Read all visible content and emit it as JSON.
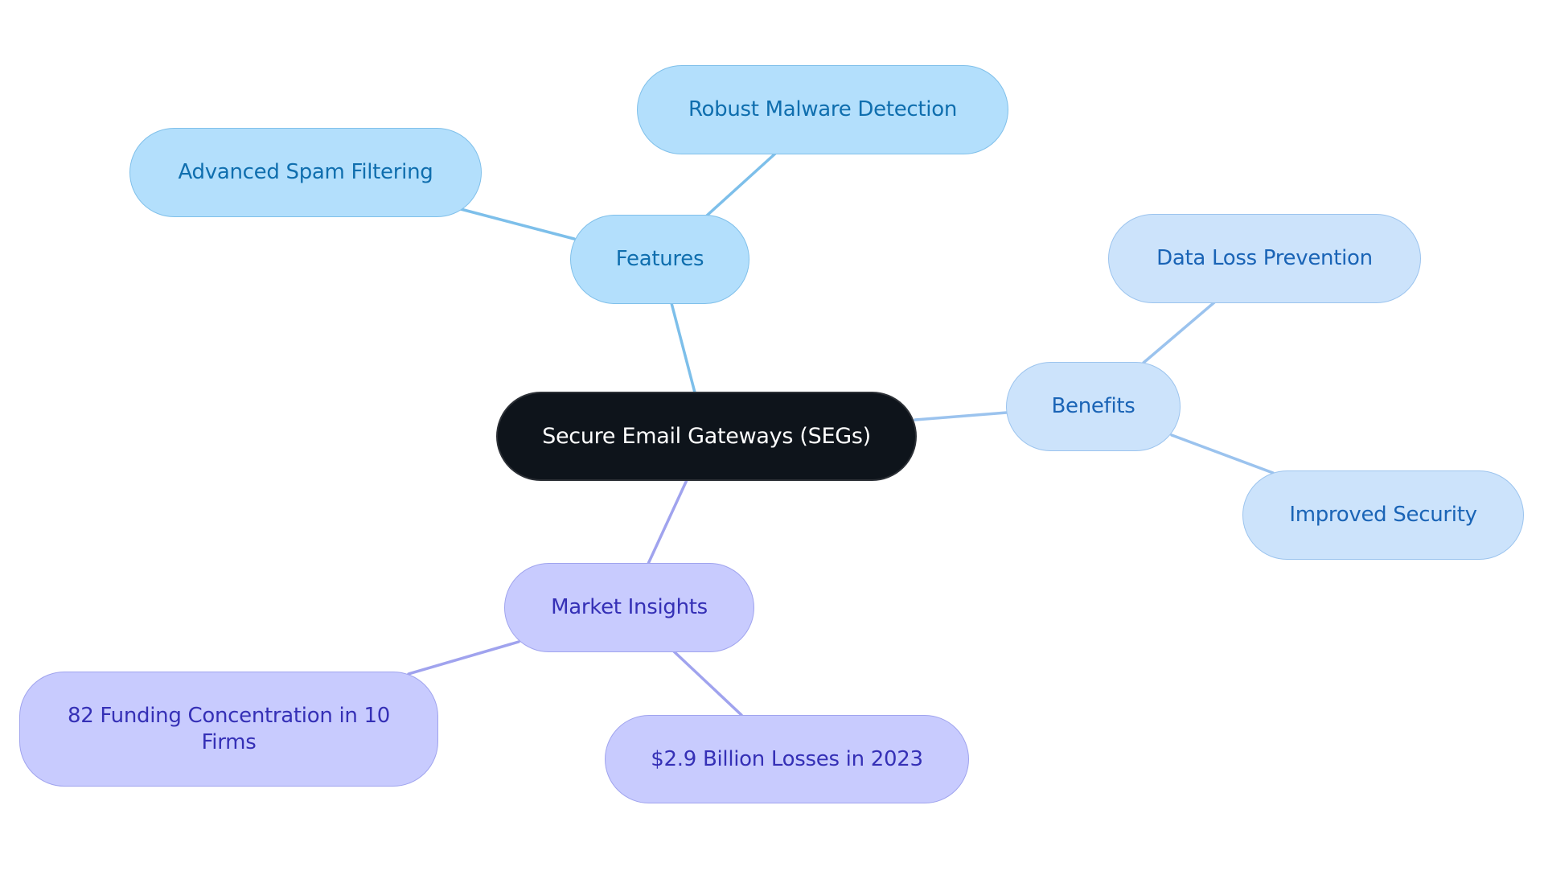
{
  "diagram": {
    "type": "mindmap",
    "root": {
      "label": "Secure Email Gateways (SEGs)",
      "colors": {
        "fill": "#0e141b",
        "border": "#2c3036",
        "text": "#ffffff"
      }
    },
    "branches": [
      {
        "id": "features",
        "label": "Features",
        "colors": {
          "fill": "#b3dffc",
          "border": "#80c0ea",
          "text": "#0f6eae",
          "edge": "#7dbfea"
        },
        "children": [
          {
            "id": "robust",
            "label": "Robust Malware Detection"
          },
          {
            "id": "spam",
            "label": "Advanced Spam Filtering"
          }
        ]
      },
      {
        "id": "benefits",
        "label": "Benefits",
        "colors": {
          "fill": "#cce3fb",
          "border": "#9cc4ee",
          "text": "#1a64b6",
          "edge": "#9bc3ee"
        },
        "children": [
          {
            "id": "dlp",
            "label": "Data Loss Prevention"
          },
          {
            "id": "improved",
            "label": "Improved Security"
          }
        ]
      },
      {
        "id": "market",
        "label": "Market Insights",
        "colors": {
          "fill": "#c8cbfe",
          "border": "#a0a4ee",
          "text": "#3530b6",
          "edge": "#a0a3ee"
        },
        "children": [
          {
            "id": "funding",
            "label": "82 Funding Concentration in 10 Firms"
          },
          {
            "id": "losses",
            "label": "$2.9 Billion Losses in 2023"
          }
        ]
      }
    ]
  }
}
